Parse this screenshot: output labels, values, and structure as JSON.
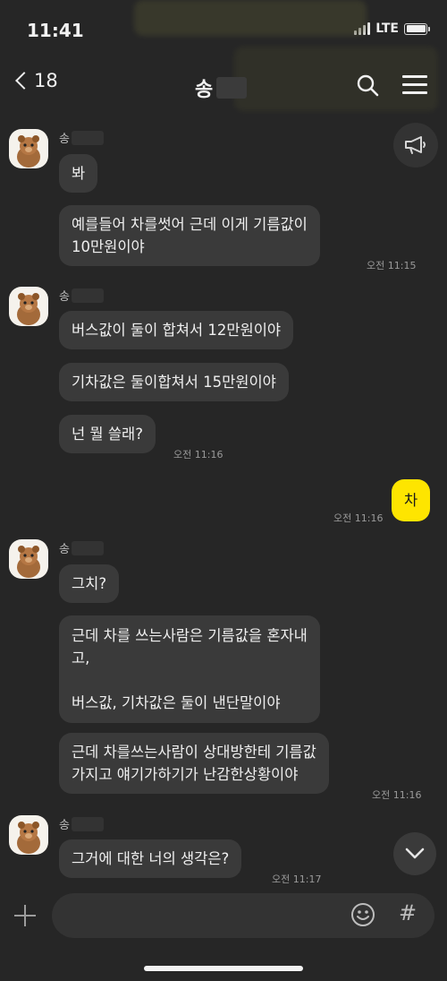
{
  "status": {
    "time": "11:41",
    "network": "LTE"
  },
  "header": {
    "back_count": "18",
    "title": "송"
  },
  "sender_name": "송",
  "groups": [
    {
      "messages": [
        "봐",
        "예를들어 차를썻어 근데 이게 기름값이\n10만원이야"
      ],
      "time": "오전 11:15"
    },
    {
      "messages": [
        "버스값이 둘이 합쳐서 12만원이야",
        "기차값은 둘이합쳐서 15만원이야",
        "넌 뭘 쓸래?"
      ],
      "time": "오전 11:16"
    },
    {
      "messages": [
        "그치?",
        "근데 차를 쓰는사람은 기름값을 혼자내\n고,\n\n버스값, 기차값은 둘이 낸단말이야",
        "근데 차를쓰는사람이 상대방한테 기름값\n가지고 얘기가하기가 난감한상황이야"
      ],
      "time": "오전 11:16"
    },
    {
      "messages": [
        "그거에 대한 너의 생각은?"
      ],
      "time": "오전 11:17"
    }
  ],
  "my_message": {
    "text": "차",
    "time": "오전 11:16"
  },
  "icons": {
    "back": "chevron-left-icon",
    "search": "search-icon",
    "menu": "hamburger-menu-icon",
    "announce": "megaphone-icon",
    "scroll": "chevron-down-icon",
    "attach": "plus-icon",
    "emoji": "emoji-icon",
    "hashtag": "hash-icon"
  },
  "input": {
    "hashtag_label": "#"
  },
  "colors": {
    "background": "#262626",
    "bubble_other": "#3a3a3a",
    "bubble_mine": "#fee500"
  }
}
